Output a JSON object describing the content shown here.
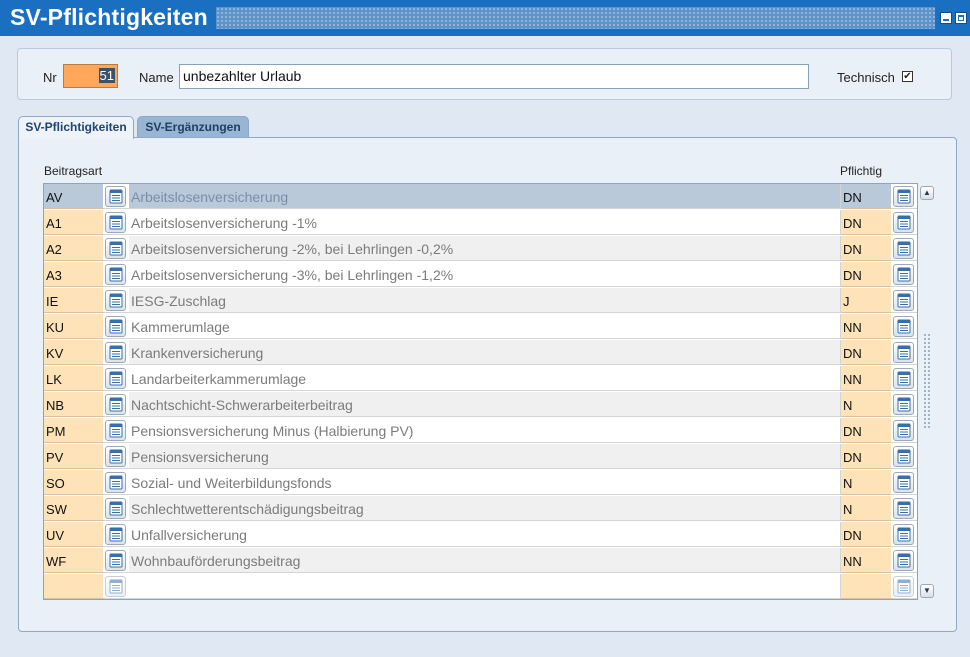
{
  "window": {
    "title": "SV-Pflichtigkeiten"
  },
  "header": {
    "nr_label": "Nr",
    "nr_value": "51",
    "name_label": "Name",
    "name_value": "unbezahlter Urlaub",
    "technisch_label": "Technisch",
    "technisch_checked": true,
    "check_glyph": "✔"
  },
  "tabs": [
    {
      "label": "SV-Pflichtigkeiten",
      "active": true
    },
    {
      "label": "SV-Ergänzungen",
      "active": false
    }
  ],
  "grid": {
    "columns": {
      "beitragsart": "Beitragsart",
      "pflichtig": "Pflichtig"
    },
    "selected_index": 0,
    "rows": [
      {
        "code": "AV",
        "desc": "Arbeitslosenversicherung",
        "pflichtig": "DN"
      },
      {
        "code": "A1",
        "desc": "Arbeitslosenversicherung -1%",
        "pflichtig": "DN"
      },
      {
        "code": "A2",
        "desc": "Arbeitslosenversicherung -2%, bei Lehrlingen -0,2%",
        "pflichtig": "DN"
      },
      {
        "code": "A3",
        "desc": "Arbeitslosenversicherung -3%, bei Lehrlingen -1,2%",
        "pflichtig": "DN"
      },
      {
        "code": "IE",
        "desc": "IESG-Zuschlag",
        "pflichtig": "J"
      },
      {
        "code": "KU",
        "desc": "Kammerumlage",
        "pflichtig": "NN"
      },
      {
        "code": "KV",
        "desc": "Krankenversicherung",
        "pflichtig": "DN"
      },
      {
        "code": "LK",
        "desc": "Landarbeiterkammerumlage",
        "pflichtig": "NN"
      },
      {
        "code": "NB",
        "desc": "Nachtschicht-Schwerarbeiterbeitrag",
        "pflichtig": "N"
      },
      {
        "code": "PM",
        "desc": "Pensionsversicherung Minus (Halbierung PV)",
        "pflichtig": "DN"
      },
      {
        "code": "PV",
        "desc": "Pensionsversicherung",
        "pflichtig": "DN"
      },
      {
        "code": "SO",
        "desc": "Sozial- und Weiterbildungsfonds",
        "pflichtig": "N"
      },
      {
        "code": "SW",
        "desc": "Schlechtwetterentschädigungsbeitrag",
        "pflichtig": "N"
      },
      {
        "code": "UV",
        "desc": "Unfallversicherung",
        "pflichtig": "DN"
      },
      {
        "code": "WF",
        "desc": "Wohnbauförderungsbeitrag",
        "pflichtig": "NN"
      },
      {
        "code": "",
        "desc": "",
        "pflichtig": ""
      }
    ]
  },
  "scrollbar": {
    "up_glyph": "▲",
    "down_glyph": "▼"
  },
  "icons": {
    "lookup": "list-lookup-icon",
    "minimize": "minimize-icon",
    "maximize": "maximize-icon"
  },
  "colors": {
    "titlebar": "#1a6fc0",
    "key_field": "#ffe3b8",
    "nr_field": "#ffa85a",
    "selected_row": "#b9c9da"
  }
}
